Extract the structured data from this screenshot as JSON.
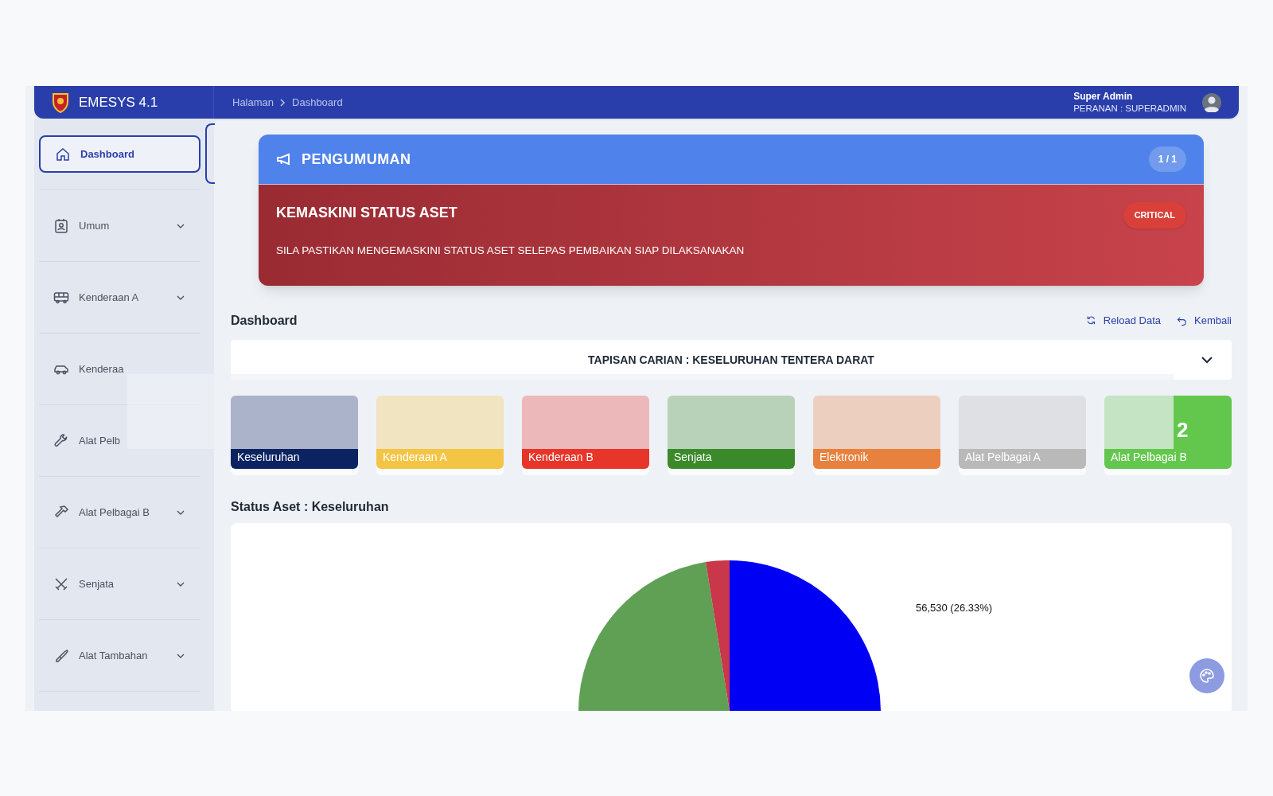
{
  "header": {
    "app_name": "EMESYS 4.1",
    "breadcrumb": [
      "Halaman",
      "Dashboard"
    ],
    "user_name": "Super Admin",
    "user_role": "PERANAN : SUPERADMIN"
  },
  "sidebar": {
    "items": [
      {
        "label": "Dashboard",
        "selected": true,
        "expandable": false
      },
      {
        "label": "Umum",
        "selected": false,
        "expandable": true
      },
      {
        "label": "Kenderaan A",
        "selected": false,
        "expandable": true
      },
      {
        "label": "Kenderaa",
        "selected": false,
        "expandable": false
      },
      {
        "label": "Alat Pelb",
        "selected": false,
        "expandable": false
      },
      {
        "label": "Alat Pelbagai B",
        "selected": false,
        "expandable": true
      },
      {
        "label": "Senjata",
        "selected": false,
        "expandable": true
      },
      {
        "label": "Alat Tambahan",
        "selected": false,
        "expandable": true
      }
    ]
  },
  "announcement": {
    "title": "PENGUMUMAN",
    "counter": "1 / 1",
    "item": {
      "title": "KEMASKINI STATUS ASET",
      "severity": "CRITICAL",
      "message": "SILA PASTIKAN MENGEMASKINI STATUS ASET SELEPAS PEMBAIKAN SIAP DILAKSANAKAN"
    }
  },
  "dashboard": {
    "title": "Dashboard",
    "actions": [
      {
        "label": "Reload Data"
      },
      {
        "label": "Kembali"
      }
    ],
    "filter": "TAPISAN CARIAN : KESELURUHAN TENTERA DARAT",
    "cards": [
      {
        "label": "Keseluruhan",
        "color": "#0b2461"
      },
      {
        "label": "Kenderaan A",
        "color": "#f4c545"
      },
      {
        "label": "Kenderaan B",
        "color": "#e8352a"
      },
      {
        "label": "Senjata",
        "color": "#3a8a2a"
      },
      {
        "label": "Elektronik",
        "color": "#e8803e"
      },
      {
        "label": "Alat Pelbagai A",
        "color": "#b9b9b9"
      },
      {
        "label": "Alat Pelbagai B",
        "color": "#63c74d",
        "value": "2"
      }
    ]
  },
  "status": {
    "title": "Status Aset : Keseluruhan",
    "chart_label": "56,530 (26.33%)"
  }
}
